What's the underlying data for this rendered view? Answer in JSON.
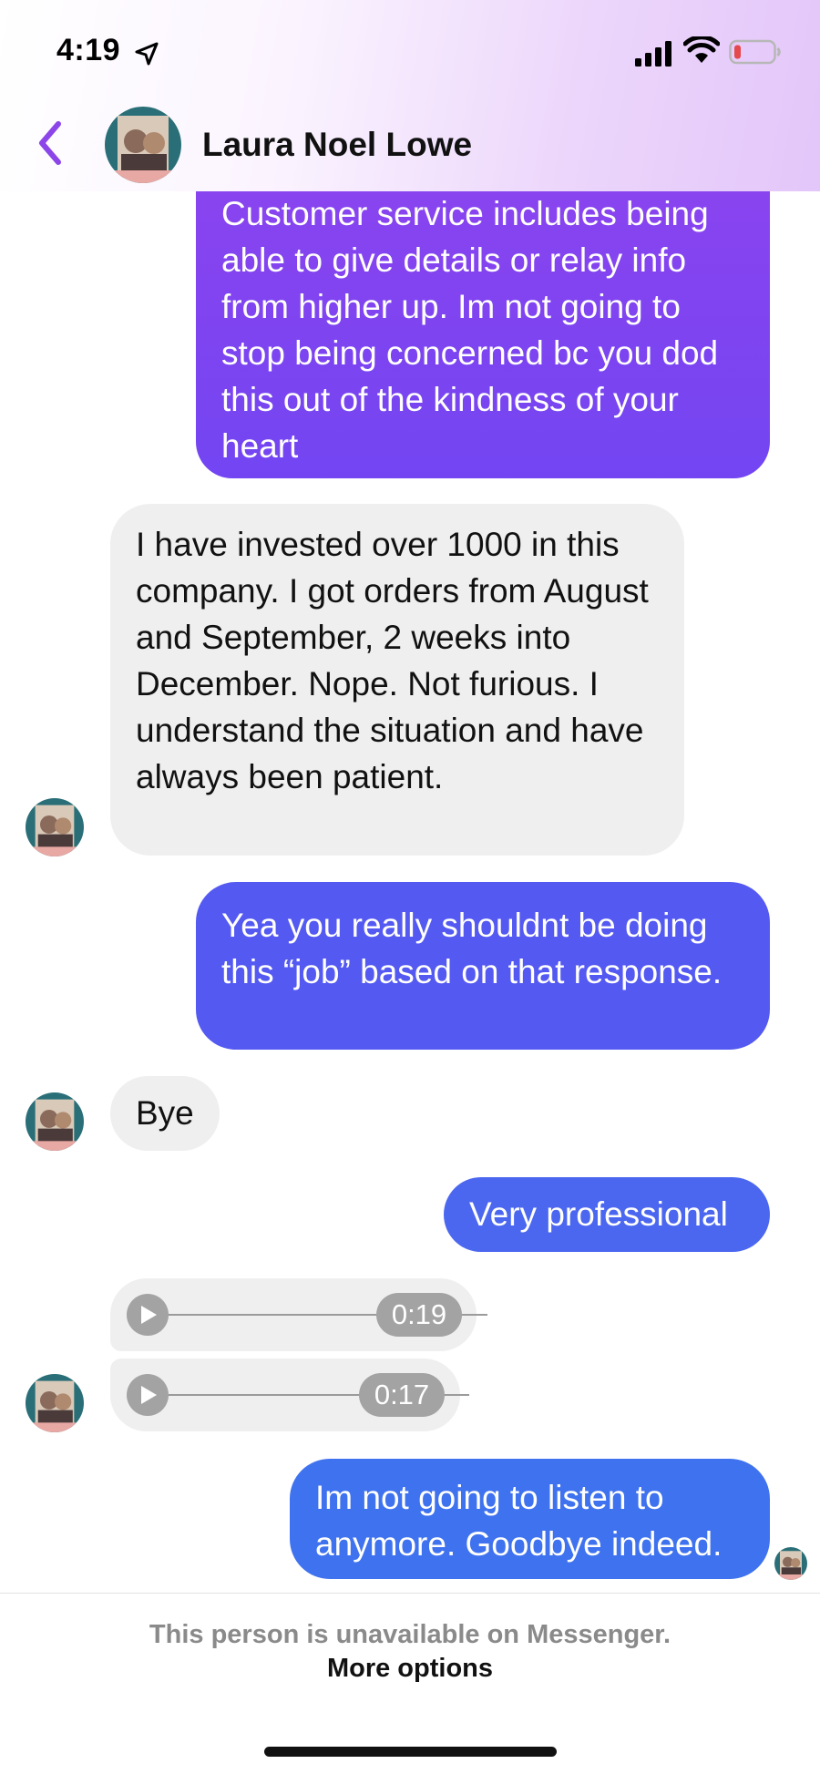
{
  "status_bar": {
    "time": "4:19",
    "icons": [
      "location-arrow-icon",
      "signal-icon",
      "wifi-icon",
      "battery-low-icon"
    ],
    "battery_color": "#e5484d"
  },
  "header": {
    "contact_name": "Laura Noel Lowe",
    "accent_color": "#8b45e8"
  },
  "messages": [
    {
      "direction": "outgoing",
      "text": "Customer service includes being able to give details or relay info from higher up. Im not going to stop being concerned bc you dod this out of the kindness of your heart"
    },
    {
      "direction": "incoming",
      "text": "I have invested over 1000 in this company. I got orders from August and September, 2 weeks into December. Nope. Not furious. I understand the situation and have always been patient."
    },
    {
      "direction": "outgoing",
      "text": "Yea you really shouldnt be doing this “job” based on that response."
    },
    {
      "direction": "incoming",
      "text": "Bye"
    },
    {
      "direction": "outgoing",
      "text": "Very professional"
    },
    {
      "direction": "incoming",
      "type": "voice",
      "duration": "0:19"
    },
    {
      "direction": "incoming",
      "type": "voice",
      "duration": "0:17"
    },
    {
      "direction": "outgoing",
      "text": "Im not going to listen to anymore. Goodbye indeed."
    }
  ],
  "footer": {
    "unavailable_text": "This person is unavailable on Messenger.",
    "more_options": "More options"
  }
}
